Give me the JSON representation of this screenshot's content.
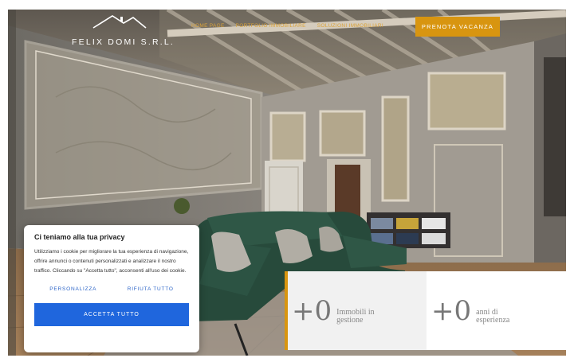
{
  "brand": {
    "name": "FELIX DOMI S.R.L.",
    "logo_icon": "house-roof-icon"
  },
  "nav": {
    "items": [
      {
        "label": "HOME PAGE"
      },
      {
        "label": "PORTFOLIO IMMOBILIARE"
      },
      {
        "label": "SOLUZIONI IMMOBILIARI"
      }
    ],
    "cta_label": "PRENOTA VACANZA"
  },
  "stats": [
    {
      "value": "+0",
      "label_line1": "Immobili in",
      "label_line2": "gestione"
    },
    {
      "value": "+0",
      "label_line1": "anni di",
      "label_line2": "esperienza"
    }
  ],
  "cookie": {
    "title": "Ci teniamo alla tua privacy",
    "text": "Utilizziamo i cookie per migliorare la tua esperienza di navigazione, offrire annunci o contenuti personalizzati e analizzare il nostro traffico. Cliccando su \"Accetta tutto\", acconsenti all'uso dei cookie.",
    "customize_label": "PERSONALIZZA",
    "reject_label": "RIFIUTA TUTTO",
    "accept_label": "ACCETTA TUTTO"
  },
  "colors": {
    "accent": "#d89510",
    "primary_button": "#1f66dd",
    "link": "#2e66c8"
  }
}
